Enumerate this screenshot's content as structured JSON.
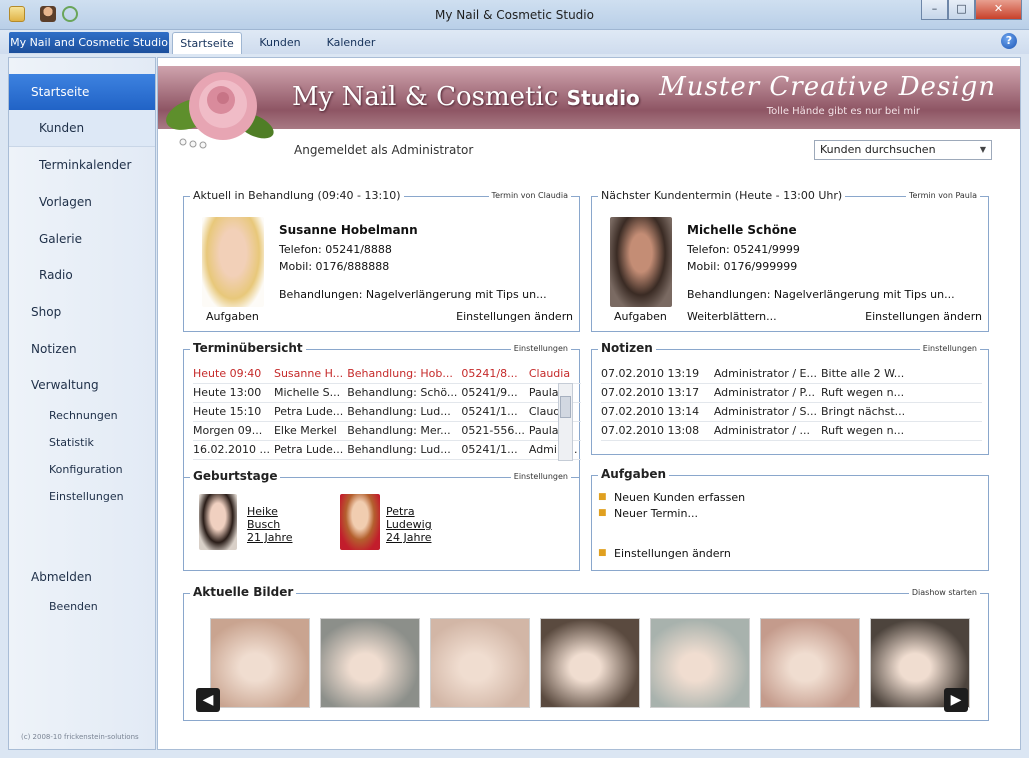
{
  "window": {
    "title": "My Nail & Cosmetic Studio"
  },
  "tabs": {
    "app_button": "My Nail and Cosmetic Studio",
    "items": [
      "Startseite",
      "Kunden",
      "Kalender"
    ],
    "help": "?"
  },
  "sidebar": {
    "items": [
      "Startseite",
      "Kunden",
      "Terminkalender",
      "Vorlagen",
      "Galerie",
      "Radio",
      "Shop",
      "Notizen",
      "Verwaltung"
    ],
    "verwaltung_sub": [
      "Rechnungen",
      "Statistik",
      "Konfiguration",
      "Einstellungen"
    ],
    "logout": "Abmelden",
    "logout_sub": [
      "Beenden"
    ],
    "copyright": "(c) 2008-10 frickenstein-solutions"
  },
  "banner": {
    "app_pre": "My N",
    "app_mid": "ail & C",
    "app_mid2": "osmetic ",
    "app_bold": "Studio",
    "brand": "Muster Creative Design",
    "slogan": "Tolle Hände gibt es nur bei mir"
  },
  "session": {
    "logged_in": "Angemeldet als Administrator"
  },
  "search": {
    "selected": "Kunden durchsuchen"
  },
  "current": {
    "header": "Aktuell in Behandlung (09:40 - 13:10)",
    "note": "Termin von Claudia",
    "name": "Susanne Hobelmann",
    "phone": "Telefon: 05241/8888",
    "mobile": "Mobil: 0176/888888",
    "treatments": "Behandlungen: Nagelverlängerung mit Tips un...",
    "link_tasks": "Aufgaben",
    "link_settings": "Einstellungen ändern"
  },
  "next": {
    "header": "Nächster Kundentermin (Heute - 13:00 Uhr)",
    "note": "Termin von Paula",
    "name": "Michelle Schöne",
    "phone": "Telefon: 05241/9999",
    "mobile": "Mobil: 0176/999999",
    "treatments": "Behandlungen: Nagelverlängerung mit Tips un...",
    "link_tasks": "Aufgaben",
    "link_more": "Weiterblättern...",
    "link_settings": "Einstellungen ändern"
  },
  "appointments": {
    "header": "Terminübersicht",
    "settings": "Einstellungen",
    "rows": [
      [
        "Heute 09:40",
        "Susanne H...",
        "Behandlung: Hob...",
        "05241/8...",
        "Claudia"
      ],
      [
        "Heute 13:00",
        "Michelle S...",
        "Behandlung: Schö...",
        "05241/9...",
        "Paula"
      ],
      [
        "Heute 15:10",
        "Petra Lude...",
        "Behandlung: Lud...",
        "05241/1...",
        "Claudia"
      ],
      [
        "Morgen 09...",
        "Elke Merkel",
        "Behandlung: Mer...",
        "0521-556...",
        "Paula"
      ],
      [
        "16.02.2010 ...",
        "Petra Lude...",
        "Behandlung: Lud...",
        "05241/1...",
        "Admini..."
      ]
    ]
  },
  "notes": {
    "header": "Notizen",
    "settings": "Einstellungen",
    "rows": [
      [
        "07.02.2010 13:19",
        "Administrator / E...",
        "Bitte alle 2 W..."
      ],
      [
        "07.02.2010 13:17",
        "Administrator / P...",
        "Ruft wegen n..."
      ],
      [
        "07.02.2010 13:14",
        "Administrator / S...",
        "Bringt nächst..."
      ],
      [
        "07.02.2010 13:08",
        "Administrator / ...",
        "Ruft wegen n..."
      ]
    ]
  },
  "birthdays": {
    "header": "Geburtstage",
    "settings": "Einstellungen",
    "people": [
      {
        "first": "Heike",
        "last": "Busch",
        "age": "21 Jahre"
      },
      {
        "first": "Petra",
        "last": "Ludewig",
        "age": "24 Jahre"
      }
    ]
  },
  "tasks": {
    "header": "Aufgaben",
    "items": [
      "Neuen Kunden erfassen",
      "Neuer Termin..."
    ],
    "settings": "Einstellungen ändern"
  },
  "gallery": {
    "header": "Aktuelle Bilder",
    "slideshow": "Diashow starten",
    "count": 7
  },
  "colors": {
    "accent_blue": "#2163c6",
    "banner_rose": "#8e5564",
    "overdue_red": "#c52a2a",
    "task_bullet": "#e0a020"
  }
}
